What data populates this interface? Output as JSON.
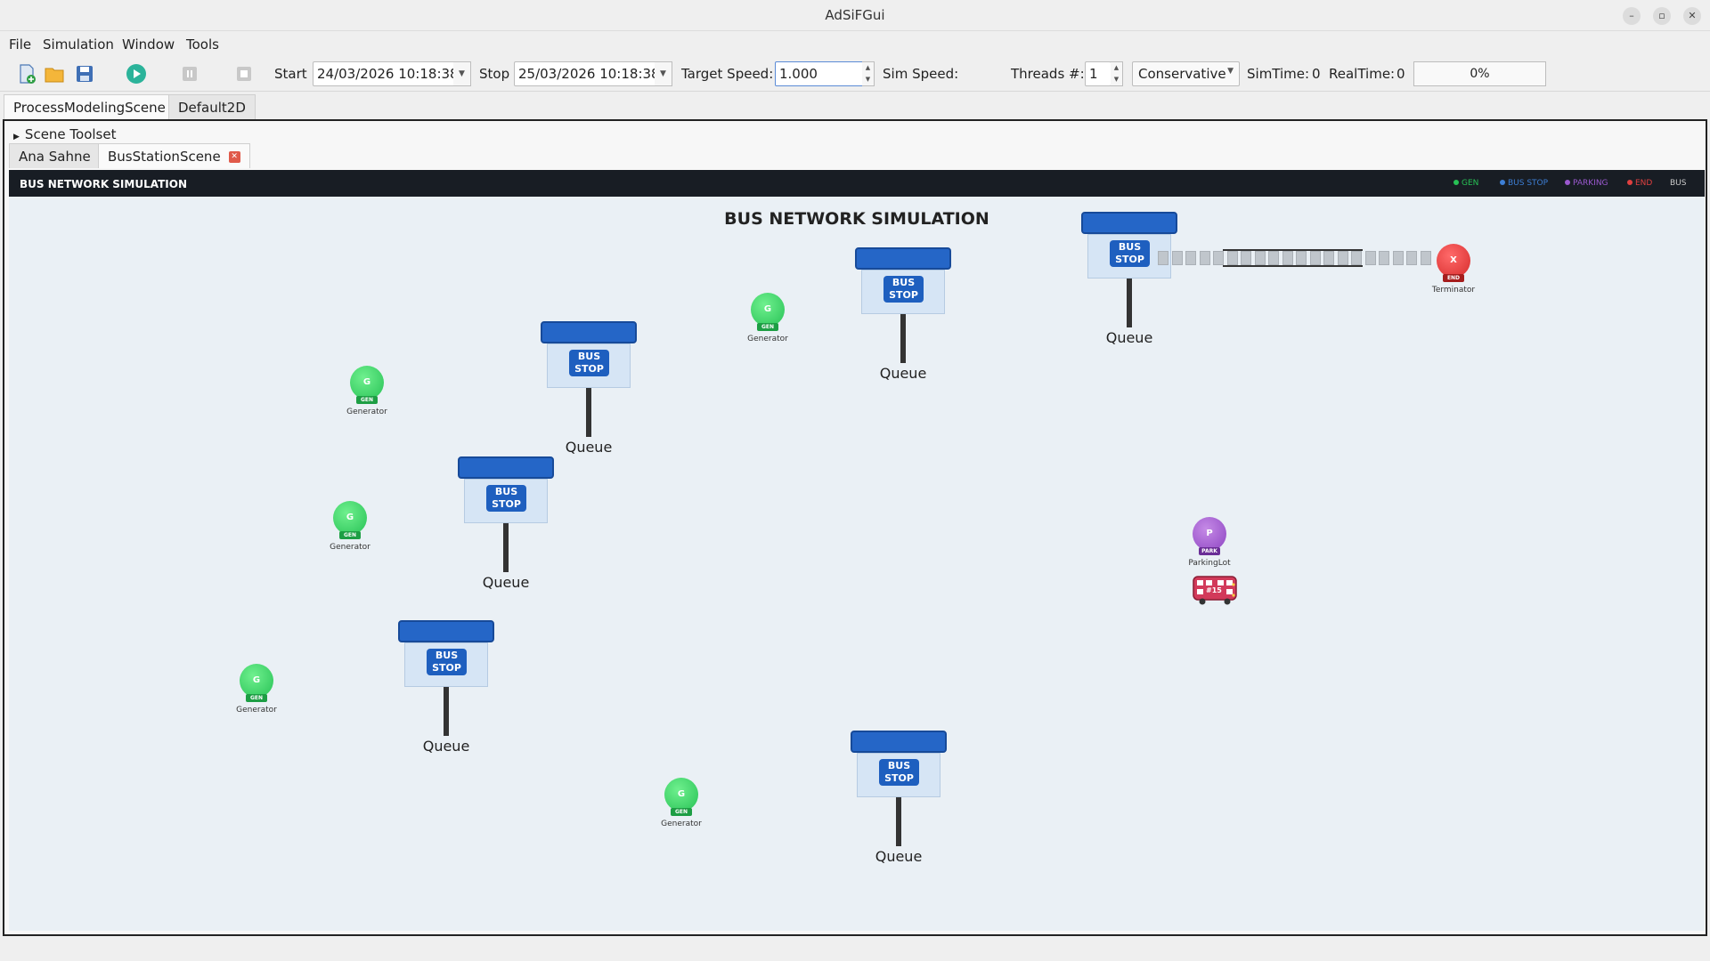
{
  "window": {
    "title": "AdSiFGui"
  },
  "menu": [
    "File",
    "Simulation",
    "Window",
    "Tools"
  ],
  "toolbar": {
    "icons": [
      "new-file-icon",
      "open-folder-icon",
      "save-icon",
      "play-icon",
      "pause-icon",
      "stop-icon"
    ],
    "start_label": "Start",
    "start_value": "24/03/2026 10:18:38",
    "stop_label": "Stop",
    "stop_value": "25/03/2026 10:18:38",
    "target_speed_label": "Target Speed:",
    "target_speed_value": "1.000",
    "sim_speed_label": "Sim Speed:",
    "threads_label": "Threads #:",
    "threads_value": "1",
    "mode_value": "Conservative",
    "simtime_label": "SimTime:",
    "simtime_value": "0",
    "realtime_label": "RealTime:",
    "realtime_value": "0",
    "progress_text": "0%"
  },
  "main_tabs": [
    "ProcessModelingScene",
    "Default2D"
  ],
  "scene_toolset": "Scene Toolset",
  "scene_tabs": [
    "Ana Sahne",
    "BusStationScene"
  ],
  "scene": {
    "header_title": "BUS NETWORK SIMULATION",
    "legend": [
      {
        "label": "GEN",
        "color": "#27c155"
      },
      {
        "label": "BUS STOP",
        "color": "#3d7fd6"
      },
      {
        "label": "PARKING",
        "color": "#9b59d0"
      },
      {
        "label": "END",
        "color": "#e04040"
      },
      {
        "label": "BUS",
        "color": "#cccccc"
      }
    ],
    "title": "BUS NETWORK SIMULATION",
    "stop_sign_line1": "BUS",
    "stop_sign_line2": "STOP",
    "queue_label": "Queue",
    "generator": {
      "ball": "G",
      "tag": "GEN",
      "label": "Generator"
    },
    "parking": {
      "ball": "P",
      "tag": "PARK",
      "label": "ParkingLot"
    },
    "terminator": {
      "ball": "X",
      "tag": "END",
      "label": "Terminator"
    },
    "bus_number": "#15"
  }
}
